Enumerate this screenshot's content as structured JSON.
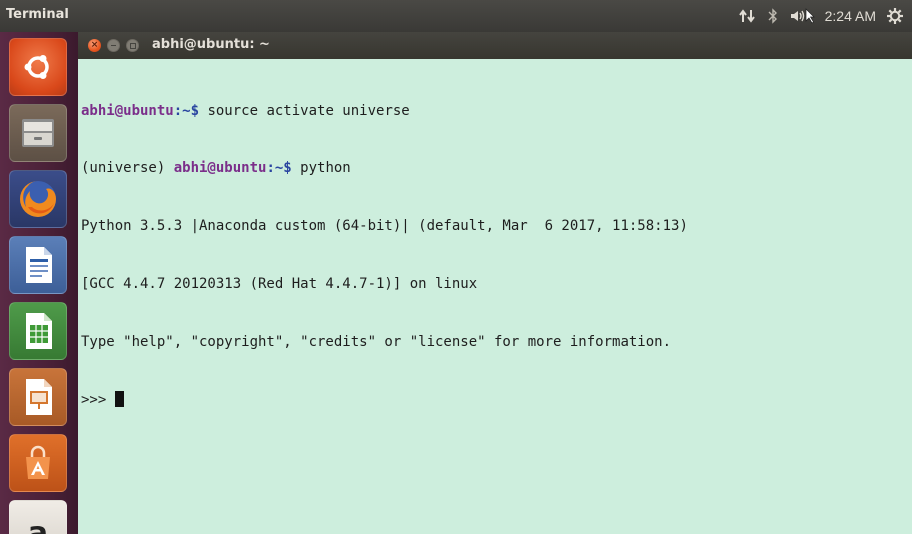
{
  "panel": {
    "app_title": "Terminal",
    "clock": "2:24 AM",
    "indicators": [
      "network-icon",
      "bluetooth-icon",
      "volume-icon",
      "settings-gear-icon"
    ]
  },
  "launcher": {
    "items": [
      "ubuntu-dash-icon",
      "files-icon",
      "firefox-icon",
      "libreoffice-writer-icon",
      "libreoffice-calc-icon",
      "libreoffice-impress-icon",
      "software-center-icon",
      "amazon-icon"
    ]
  },
  "window": {
    "title": "abhi@ubuntu: ~",
    "close_glyph": "×"
  },
  "terminal": {
    "line1": {
      "user": "abhi@ubuntu",
      "path": ":~$",
      "command": " source activate universe"
    },
    "line2": {
      "env": "(universe) ",
      "user": "abhi@ubuntu",
      "path": ":~$",
      "command": " python"
    },
    "line3": "Python 3.5.3 |Anaconda custom (64-bit)| (default, Mar  6 2017, 11:58:13)",
    "line4": "[GCC 4.4.7 20120313 (Red Hat 4.4.7-1)] on linux",
    "line5": "Type \"help\", \"copyright\", \"credits\" or \"license\" for more information.",
    "prompt": ">>> "
  },
  "colors": {
    "terminal_bg": "#cdeedd",
    "user_color": "#7b2e8a",
    "path_color": "#2a45a0",
    "close_button": "#e7561f"
  }
}
